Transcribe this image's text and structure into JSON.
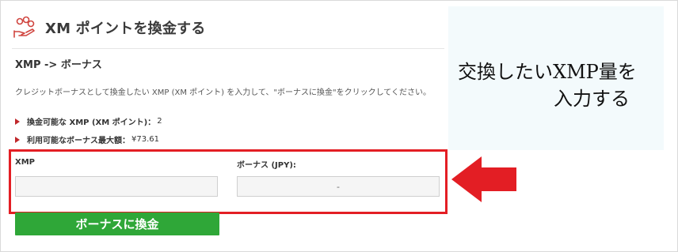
{
  "header": {
    "title": "XM ポイントを換金する",
    "icon": "hand-coins-icon"
  },
  "section": {
    "title": "XMP -> ボーナス"
  },
  "description": "クレジットボーナスとして換金したい XMP (XM ポイント) を入力して、\"ボーナスに換金\"をクリックしてください。",
  "info": [
    {
      "label": "換金可能な XMP (XM ポイント)：",
      "value": "2"
    },
    {
      "label": "利用可能なボーナス最大額：",
      "value": "¥73.61"
    }
  ],
  "form": {
    "xmp_label": "XMP",
    "xmp_value": "",
    "bonus_label": "ボーナス (JPY):",
    "bonus_value": "-"
  },
  "convert_button": "ボーナスに換金",
  "callout": {
    "line1": "交換したいXMP量を",
    "line2": "入力する"
  },
  "colors": {
    "accent_red": "#e31e24",
    "button_green": "#2fa738"
  }
}
